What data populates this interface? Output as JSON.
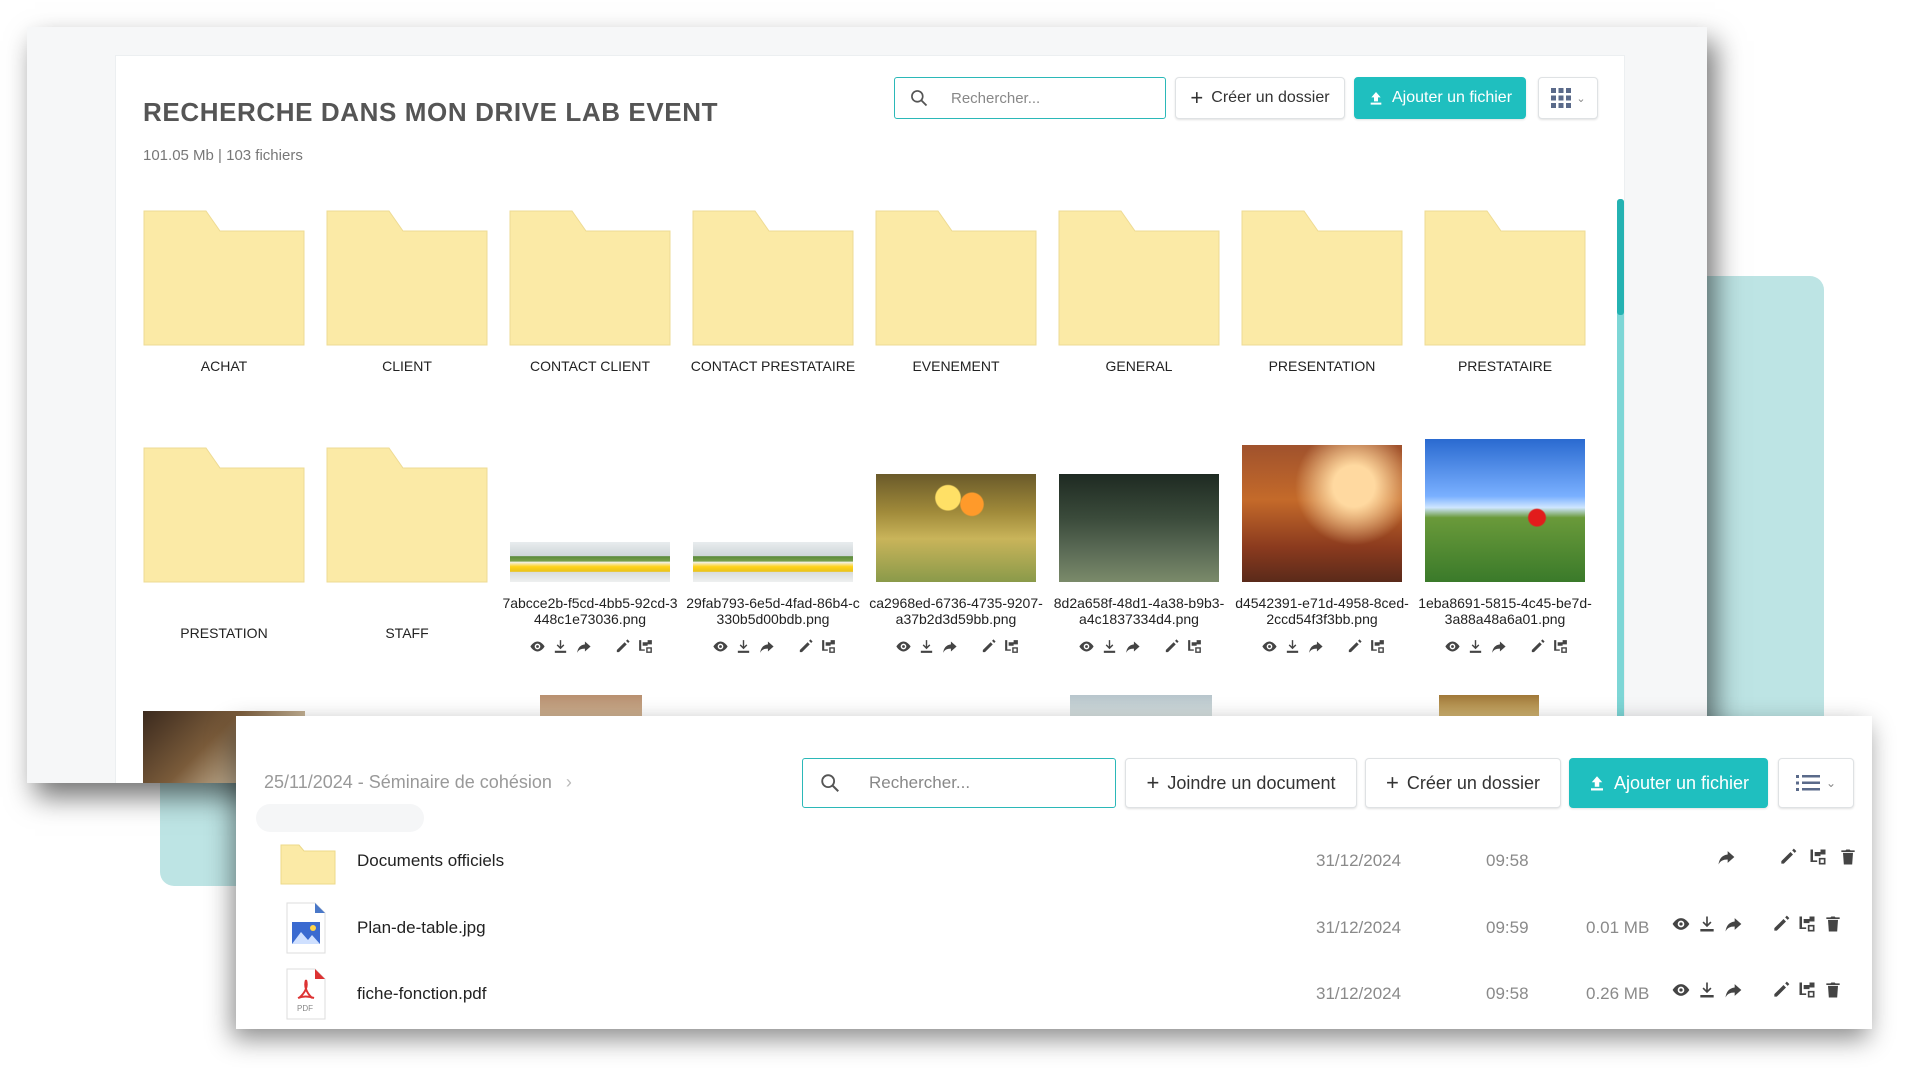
{
  "drive": {
    "title": "RECHERCHE DANS MON DRIVE LAB EVENT",
    "stats": "101.05 Mb | 103 fichiers",
    "search_placeholder": "Rechercher...",
    "create_folder_label": "Créer un dossier",
    "add_file_label": "Ajouter un fichier",
    "view_toggle_icon": "grid-icon",
    "folders_row1": [
      "ACHAT",
      "CLIENT",
      "CONTACT CLIENT",
      "CONTACT PRESTATAIRE",
      "EVENEMENT",
      "GENERAL",
      "PRESENTATION",
      "PRESTATAIRE"
    ],
    "folders_row2": [
      "PRESTATION",
      "STAFF"
    ],
    "files": [
      {
        "name": "7abcce2b-f5cd-4bb5-92cd-3448c1e73036.png",
        "thumb": "office-chairs"
      },
      {
        "name": "29fab793-6e5d-4fad-86b4-c330b5d00bdb.png",
        "thumb": "office-chairs"
      },
      {
        "name": "ca2968ed-6736-4735-9207-a37b2d3d59bb.png",
        "thumb": "balloons-field"
      },
      {
        "name": "8d2a658f-48d1-4a38-b9b3-a4c1837334d4.png",
        "thumb": "kids-camera"
      },
      {
        "name": "d4542391-e71d-4958-8ced-2ccd54f3f3bb.png",
        "thumb": "woman-sunset"
      },
      {
        "name": "1eba8691-5815-4c45-be7d-3a88a48a6a01.png",
        "thumb": "bicycle-poppy"
      }
    ],
    "file_action_icons": [
      "eye-icon",
      "download-icon",
      "share-icon",
      "pencil-icon",
      "move-icon"
    ]
  },
  "folder_view": {
    "breadcrumb": "25/11/2024 - Séminaire de cohésion",
    "breadcrumb_sep": "›",
    "search_placeholder": "Rechercher...",
    "join_document_label": "Joindre un document",
    "create_folder_label": "Créer un dossier",
    "add_file_label": "Ajouter un fichier",
    "view_toggle_icon": "list-icon",
    "rows": [
      {
        "type": "folder",
        "name": "Documents officiels",
        "date": "31/12/2024",
        "time": "09:58",
        "size": ""
      },
      {
        "type": "image",
        "name": "Plan-de-table.jpg",
        "date": "31/12/2024",
        "time": "09:59",
        "size": "0.01 MB"
      },
      {
        "type": "pdf",
        "name": "fiche-fonction.pdf",
        "date": "31/12/2024",
        "time": "09:58",
        "size": "0.26 MB",
        "badge": "PDF"
      }
    ]
  },
  "colors": {
    "accent": "#1fbfbf",
    "folder": "#fbeaa6",
    "teal_back": "#bde4e4"
  }
}
